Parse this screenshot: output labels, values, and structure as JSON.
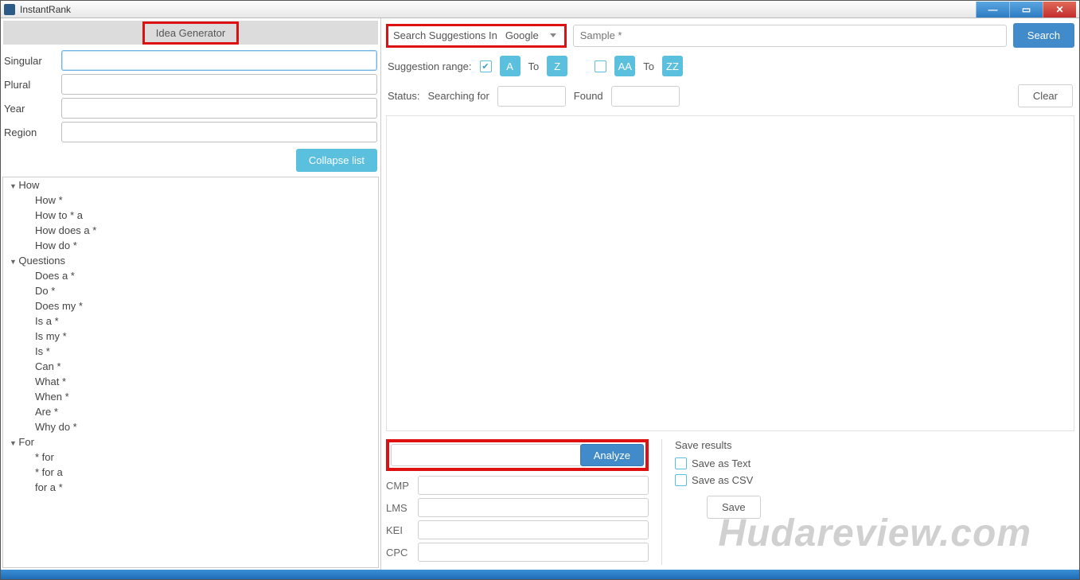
{
  "app": {
    "title": "InstantRank"
  },
  "left": {
    "tab_label": "Idea Generator",
    "fields": {
      "singular": "Singular",
      "plural": "Plural",
      "year": "Year",
      "region": "Region"
    },
    "collapse_btn": "Collapse list",
    "tree": [
      {
        "label": "How",
        "items": [
          "How *",
          "How to * a",
          "How does a  *",
          "How do  *"
        ]
      },
      {
        "label": "Questions",
        "items": [
          "Does a  *",
          "Do  *",
          "Does my  *",
          "Is a  *",
          "Is my  *",
          "Is *",
          "Can *",
          "What *",
          "When *",
          "Are  *",
          "Why do  *"
        ]
      },
      {
        "label": "For",
        "items": [
          "* for",
          "* for a",
          "for a *"
        ]
      }
    ]
  },
  "right": {
    "search_in_label": "Search Suggestions In",
    "engine": "Google",
    "sample_placeholder": "Sample *",
    "search_btn": "Search",
    "range_label": "Suggestion range:",
    "range": {
      "from1": "A",
      "to_label": "To",
      "to1": "Z",
      "from2": "AA",
      "to2": "ZZ"
    },
    "status_label": "Status:",
    "searching_label": "Searching for",
    "found_label": "Found",
    "clear_btn": "Clear"
  },
  "analyze": {
    "btn": "Analyze",
    "metrics": {
      "cmp": "CMP",
      "lms": "LMS",
      "kei": "KEI",
      "cpc": "CPC"
    }
  },
  "save": {
    "header": "Save results",
    "as_text": "Save as Text",
    "as_csv": "Save as CSV",
    "btn": "Save"
  },
  "watermark": "Hudareview.com"
}
